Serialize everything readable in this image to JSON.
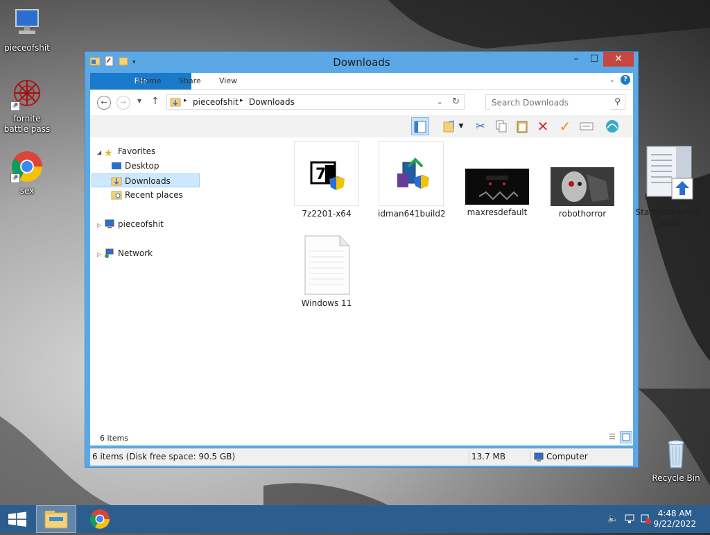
{
  "desktop": {
    "icons": [
      {
        "label": "pieceofshit",
        "icon": "computer-icon"
      },
      {
        "label": "fornite battle pass",
        "icon": "red-web-icon"
      },
      {
        "label": "sex",
        "icon": "chrome-icon"
      },
      {
        "label": "Recycle Bin",
        "icon": "recycle-bin-icon"
      }
    ]
  },
  "window": {
    "title": "Downloads",
    "buttons": {
      "minimize": "–",
      "maximize": "☐",
      "close": "✕"
    },
    "ribbon": {
      "tabs": [
        "File",
        "Home",
        "Share",
        "View"
      ]
    },
    "address": {
      "crumbs": [
        "pieceofshit",
        "Downloads"
      ],
      "separator": "▸"
    },
    "search": {
      "placeholder": "Search Downloads"
    },
    "nav": {
      "favorites": "Favorites",
      "desktop": "Desktop",
      "downloads": "Downloads",
      "recent": "Recent places",
      "computer": "pieceofshit",
      "network": "Network"
    },
    "files": [
      {
        "name": "7z2201-x64",
        "icon": "7zip-installer-icon"
      },
      {
        "name": "idman641build2",
        "icon": "idm-installer-icon"
      },
      {
        "name": "maxresdefault",
        "icon": "image-thumbnail"
      },
      {
        "name": "robothorror",
        "icon": "image-thumbnail"
      },
      {
        "name": "StartIsBackPlus_setup",
        "icon": "setup-icon"
      },
      {
        "name": "Windows 11",
        "icon": "text-document-icon"
      }
    ],
    "items_count": "6 items",
    "status": {
      "left": "6 items (Disk free space: 90.5 GB)",
      "size": "13.7 MB",
      "location": "Computer"
    }
  },
  "taskbar": {
    "time": "4:48 AM",
    "date": "9/22/2022"
  },
  "colors": {
    "window_frame": "#5aa8e6",
    "file_tab": "#1979ca",
    "taskbar": "#2c5d8f",
    "close_button": "#c7463f"
  }
}
